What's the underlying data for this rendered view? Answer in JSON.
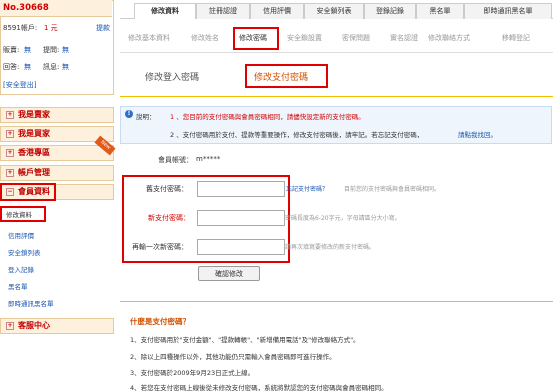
{
  "account": {
    "id": "No.30668",
    "balance_label": "8591帳戶:",
    "balance_value": "1 元",
    "withdraw": "提款",
    "sell_label": "販賣:",
    "sell_value": "無",
    "question_label": "提問:",
    "question_value": "無",
    "reply_label": "回答:",
    "reply_value": "無",
    "message_label": "訊息:",
    "message_value": "無",
    "logout": "[安全登出]"
  },
  "sidebar": {
    "menus": [
      "我是賣家",
      "我是買家",
      "香港專區",
      "帳戶管理",
      "會員資料"
    ],
    "new_badge": "New",
    "sub_items": [
      "修改資料",
      "信用評價",
      "安全鎖列表",
      "登入記錄",
      "黑名單",
      "即時通訊黑名單"
    ],
    "support": "客服中心"
  },
  "tabs": [
    "修改資料",
    "註冊認證",
    "信用評價",
    "安全鎖列表",
    "登錄記錄",
    "黑名單",
    "即時通訊黑名單"
  ],
  "subtabs": [
    "修改基本資料",
    "修改姓名",
    "修改密碼",
    "安全鎖設置",
    "密保問題",
    "實名認證",
    "修改聯絡方式",
    "移轉登記"
  ],
  "password_tabs": [
    "修改登入密碼",
    "修改支付密碼"
  ],
  "notice": {
    "label": "說明：",
    "line1": "1 、您目前的支付密碼與會員密碼相同，請儘快設定新的支付密碼。",
    "line2a": "2 、支付密碼用於支付、提款等重要操作，修改支付密碼後，請牢記。若忘記支付密碼，",
    "line2b": "請點我找回。"
  },
  "form": {
    "account_label": "會員帳號：",
    "account_value": "m*****",
    "old_label": "舊支付密碼：",
    "forgot": "忘記支付密碼？",
    "old_hint": "目前您的支付密碼與會員密碼相同。",
    "new_label": "新支付密碼：",
    "new_hint": "密碼長度為6-20字元，字母請區分大小寫。",
    "confirm_label": "再輸一次新密碼：",
    "confirm_hint": "請再次填寫要修改的新支付密碼。",
    "submit": "確認修改"
  },
  "info": {
    "title": "什麼是支付密碼？",
    "items": [
      "1、支付密碼用於\"支付金額\"、\"提款轉帳\"、\"新增備用電話\"及\"修改聯絡方式\"。",
      "2、除以上四種操作以外，其他功能仍只需輸入會員密碼即可進行操作。",
      "3、支付密碼於2009年9月23日正式上線。",
      "4、若您在支付密碼上線後從未修改支付密碼，系統將默認您的支付密碼與會員密碼相同。"
    ]
  }
}
